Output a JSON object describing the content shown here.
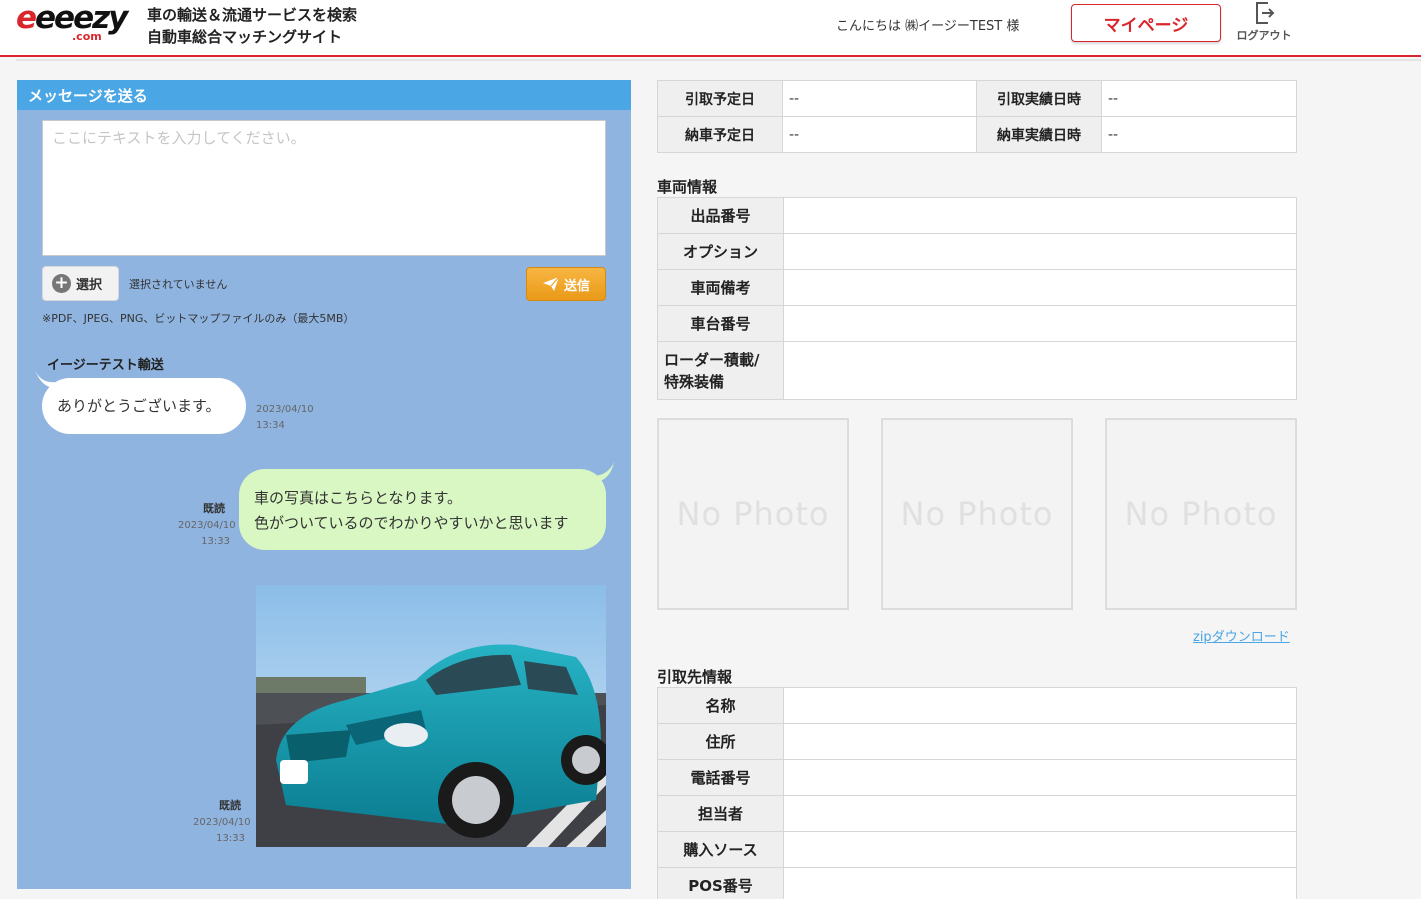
{
  "header": {
    "logo_main_prefix": "e",
    "logo_main_rest": "eeezy",
    "logo_com": ".com",
    "tagline_line1": "車の輸送＆流通サービスを検索",
    "tagline_line2": "自動車総合マッチングサイト",
    "greeting": "こんにちは ㈱イージーTEST 様",
    "mypage_label": "マイページ",
    "logout_label": "ログアウト"
  },
  "message_panel": {
    "title": "メッセージを送る",
    "textarea_placeholder": "ここにテキストを入力してください。",
    "select_label": "選択",
    "no_file_label": "選択されていません",
    "send_label": "送信",
    "file_note": "※PDF、JPEG、PNG、ビットマップファイルのみ（最大5MB）",
    "messages": [
      {
        "sender": "イージーテスト輸送",
        "text": "ありがとうございます。",
        "date": "2023/04/10",
        "time": "13:34"
      },
      {
        "status": "既読",
        "line1": "車の写真はこちらとなります。",
        "line2": "色がついているのでわかりやすいかと思います",
        "date": "2023/04/10",
        "time": "13:33"
      },
      {
        "status": "既読",
        "date": "2023/04/10",
        "time": "13:33"
      }
    ]
  },
  "dates": {
    "pickup_planned_label": "引取予定日",
    "pickup_planned_value": "--",
    "pickup_actual_label": "引取実績日時",
    "pickup_actual_value": "--",
    "delivery_planned_label": "納車予定日",
    "delivery_planned_value": "--",
    "delivery_actual_label": "納車実績日時",
    "delivery_actual_value": "--"
  },
  "vehicle_info": {
    "title": "車両情報",
    "rows": [
      "出品番号",
      "オプション",
      "車両備考",
      "車台番号"
    ],
    "loader_line1": "ローダー積載/",
    "loader_line2": "特殊装備"
  },
  "photos": {
    "no_photo_label": "No Photo",
    "zip_download": "zipダウンロード"
  },
  "pickup_info": {
    "title": "引取先情報",
    "rows": [
      "名称",
      "住所",
      "電話番号",
      "担当者",
      "購入ソース",
      "POS番号"
    ]
  },
  "colors": {
    "brand_red": "#d9262c",
    "panel_blue": "#8fb4e0",
    "header_blue": "#4aa6e4",
    "bubble_green": "#d9f7c3",
    "send_orange": "#f2a630"
  }
}
